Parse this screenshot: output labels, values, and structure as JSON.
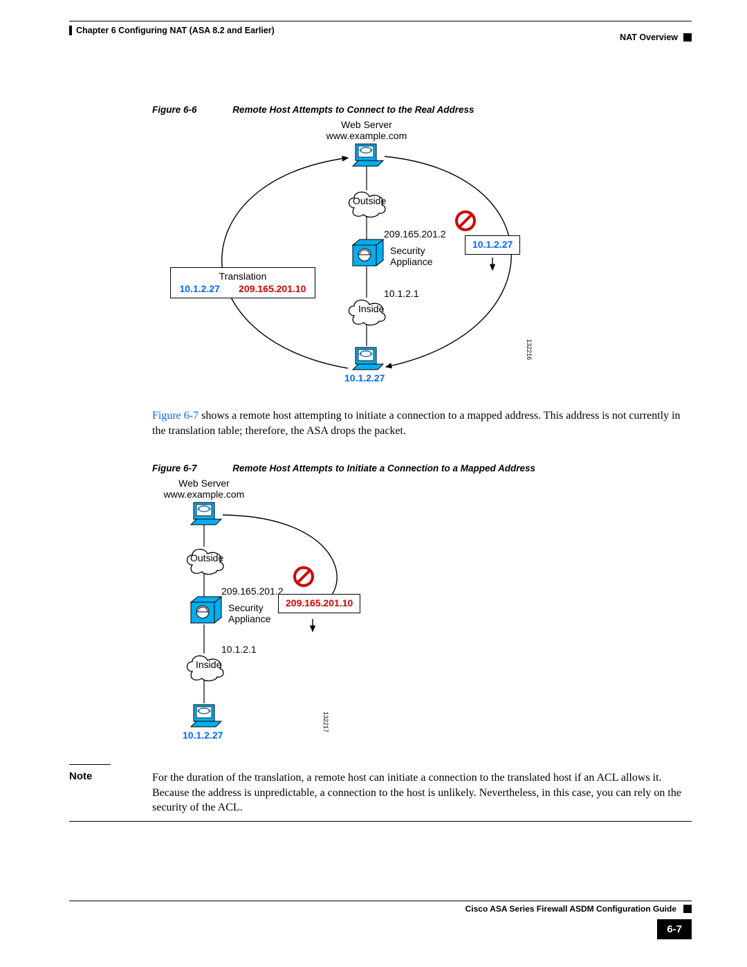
{
  "header": {
    "chapter_left": "Chapter 6    Configuring NAT (ASA 8.2 and Earlier)",
    "section_right": "NAT Overview"
  },
  "figure6": {
    "num": "Figure 6-6",
    "title": "Remote Host Attempts to Connect to the Real Address",
    "web_server_label": "Web Server",
    "web_server_host": "www.example.com",
    "outside_label": "Outside",
    "asa_outside_ip": "209.165.201.2",
    "security_label": "Security",
    "appliance_label": "Appliance",
    "asa_inside_ip": "10.1.2.1",
    "inside_label": "Inside",
    "host_ip": "10.1.2.27",
    "packet_ip": "10.1.2.27",
    "translation_label": "Translation",
    "translation_src": "10.1.2.27",
    "translation_dst": "209.165.201.10",
    "fig_code": "132216"
  },
  "para1_link": "Figure 6-7",
  "para1_rest": " shows a remote host attempting to initiate a connection to a mapped address. This address is not currently in the translation table; therefore, the ASA drops the packet.",
  "figure7": {
    "num": "Figure 6-7",
    "title": "Remote Host Attempts to Initiate a Connection to a Mapped Address",
    "web_server_label": "Web Server",
    "web_server_host": "www.example.com",
    "outside_label": "Outside",
    "asa_outside_ip": "209.165.201.2",
    "security_label": "Security",
    "appliance_label": "Appliance",
    "asa_inside_ip": "10.1.2.1",
    "inside_label": "Inside",
    "host_ip": "10.1.2.27",
    "packet_ip": "209.165.201.10",
    "fig_code": "132217"
  },
  "note": {
    "label": "Note",
    "body": "For the duration of the translation, a remote host can initiate a connection to the translated host if an ACL allows it. Because the address is unpredictable, a connection to the host is unlikely. Nevertheless, in this case, you can rely on the security of the ACL."
  },
  "footer": {
    "guide": "Cisco ASA Series Firewall ASDM Configuration Guide",
    "page": "6-7"
  }
}
